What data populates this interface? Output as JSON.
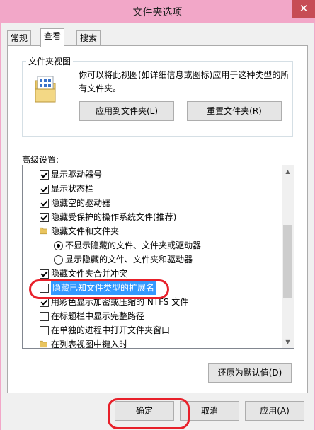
{
  "window": {
    "title": "文件夹选项",
    "close_glyph": "✕"
  },
  "tabs": [
    {
      "label": "常规"
    },
    {
      "label": "查看"
    },
    {
      "label": "搜索"
    }
  ],
  "folder_view": {
    "caption": "文件夹视图",
    "description": "你可以将此视图(如详细信息或图标)应用于这种类型的所有文件夹。",
    "apply_button": "应用到文件夹(L)",
    "reset_button": "重置文件夹(R)"
  },
  "advanced": {
    "label": "高级设置:",
    "items": [
      {
        "type": "checkbox",
        "checked": true,
        "label": "显示驱动器号"
      },
      {
        "type": "checkbox",
        "checked": true,
        "label": "显示状态栏"
      },
      {
        "type": "checkbox",
        "checked": true,
        "label": "隐藏空的驱动器"
      },
      {
        "type": "checkbox",
        "checked": true,
        "label": "隐藏受保护的操作系统文件(推荐)"
      },
      {
        "type": "folder",
        "checked": false,
        "label": "隐藏文件和文件夹"
      },
      {
        "type": "radio",
        "checked": true,
        "label": "不显示隐藏的文件、文件夹或驱动器"
      },
      {
        "type": "radio",
        "checked": false,
        "label": "显示隐藏的文件、文件夹和驱动器"
      },
      {
        "type": "checkbox",
        "checked": true,
        "label": "隐藏文件夹合并冲突"
      },
      {
        "type": "checkbox",
        "checked": false,
        "label": "隐藏已知文件类型的扩展名"
      },
      {
        "type": "checkbox",
        "checked": true,
        "label": "用彩色显示加密或压缩的 NTFS 文件"
      },
      {
        "type": "checkbox",
        "checked": false,
        "label": "在标题栏中显示完整路径"
      },
      {
        "type": "checkbox",
        "checked": false,
        "label": "在单独的进程中打开文件夹窗口"
      },
      {
        "type": "folder",
        "checked": false,
        "label": "在列表视图中键入时"
      }
    ],
    "restore_button": "还原为默认值(D)"
  },
  "footer": {
    "ok_button": "确定",
    "cancel_button": "取消",
    "apply_button": "应用(A)"
  },
  "colors": {
    "title_bar": "#f2a7c8",
    "close_button": "#c74c55",
    "selection": "#3399ff",
    "annotation_oval": "#e8202a"
  }
}
